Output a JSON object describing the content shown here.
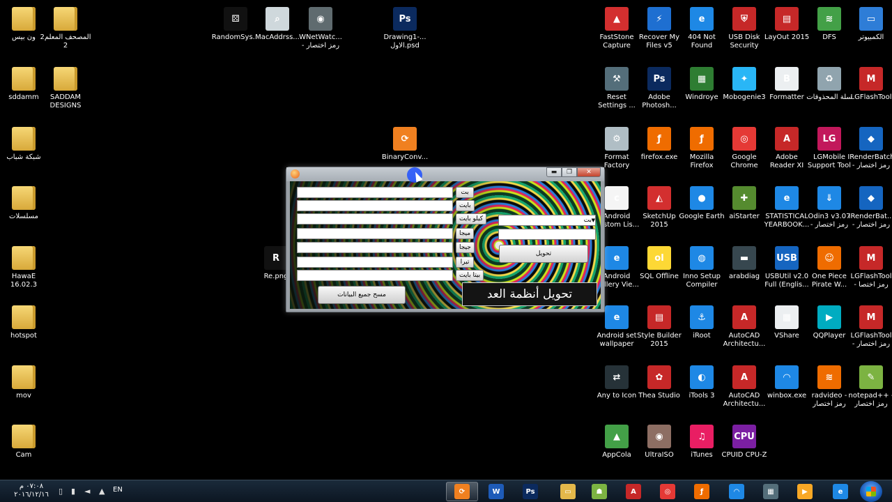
{
  "desktop": {
    "left_icons": [
      {
        "label": "ون بيس",
        "kind": "folder"
      },
      {
        "label": "المصحف المعلم2\n2",
        "kind": "folder"
      },
      {
        "label": "sddamm",
        "kind": "folder"
      },
      {
        "label": "SADDAM\nDESIGNS",
        "kind": "folder"
      },
      {
        "label": "شبكة شباب",
        "kind": "folder"
      },
      {
        "label": "مسلسلات",
        "kind": "folder"
      },
      {
        "label": "HawaE\n16.02.3",
        "kind": "folder"
      },
      {
        "label": "hotspot",
        "kind": "folder"
      },
      {
        "label": "mov",
        "kind": "folder"
      },
      {
        "label": "Cam",
        "kind": "folder"
      }
    ],
    "center_icons": [
      {
        "label": "RandomSys...",
        "glyph": "⚄",
        "color": "#111111"
      },
      {
        "label": "MacAddrss...",
        "glyph": "⌕",
        "color": "#cfd8dc"
      },
      {
        "label": "WNetWatc...\n- رمز اختصار",
        "glyph": "◉",
        "color": "#5f6b6f"
      },
      {
        "label": "Drawing1-...\nالاول.psd",
        "glyph": "Ps",
        "color": "#0b2a5e"
      },
      {
        "label": "BinaryConv...",
        "glyph": "⟳",
        "color": "#f08020"
      },
      {
        "label": "Re.png",
        "glyph": "R",
        "color": "#111111"
      }
    ],
    "right_icons": [
      {
        "label": "FastStone\nCapture",
        "glyph": "▲",
        "color": "#d32f2f"
      },
      {
        "label": "Recover My\nFiles v5",
        "glyph": "⚡",
        "color": "#1e6fd1"
      },
      {
        "label": "404 Not\nFound",
        "glyph": "e",
        "color": "#1e88e5"
      },
      {
        "label": "USB Disk\nSecurity",
        "glyph": "⛨",
        "color": "#c62828"
      },
      {
        "label": "LayOut 2015",
        "glyph": "▤",
        "color": "#c62828"
      },
      {
        "label": "DFS",
        "glyph": "≋",
        "color": "#43a047"
      },
      {
        "label": "الكمبيوتر",
        "glyph": "▭",
        "color": "#2e7dd7"
      },
      {
        "label": "Reset\nSettings ...",
        "glyph": "⚒",
        "color": "#546e7a"
      },
      {
        "label": "Adobe\nPhotosh...",
        "glyph": "Ps",
        "color": "#0b2a5e"
      },
      {
        "label": "Windroye",
        "glyph": "▦",
        "color": "#2e7d32"
      },
      {
        "label": "Mobogenie3",
        "glyph": "✦",
        "color": "#29b6f6"
      },
      {
        "label": "Formatter",
        "glyph": "B",
        "color": "#eceff1"
      },
      {
        "label": "سلة المحذوفات",
        "glyph": "♻",
        "color": "#90a4ae"
      },
      {
        "label": "LGFlashTool",
        "glyph": "M",
        "color": "#c62828"
      },
      {
        "label": "Format\nFactory",
        "glyph": "⚙",
        "color": "#b0bec5"
      },
      {
        "label": "firefox.exe",
        "glyph": "ƒ",
        "color": "#ef6c00"
      },
      {
        "label": "Mozilla\nFirefox",
        "glyph": "ƒ",
        "color": "#ef6c00"
      },
      {
        "label": "Google\nChrome",
        "glyph": "◎",
        "color": "#e53935"
      },
      {
        "label": "Adobe\nReader XI",
        "glyph": "A",
        "color": "#c62828"
      },
      {
        "label": "LGMobile\nSupport Tool",
        "glyph": "LG",
        "color": "#c2185b"
      },
      {
        "label": "IRenderBatch\n- رمز اختصار",
        "glyph": "◆",
        "color": "#1565c0"
      },
      {
        "label": "Android\nCustom Lis...",
        "glyph": "c",
        "color": "#f5f5f5"
      },
      {
        "label": "SketchUp\n2015",
        "glyph": "◭",
        "color": "#d32f2f"
      },
      {
        "label": "Google Earth",
        "glyph": "●",
        "color": "#1e88e5"
      },
      {
        "label": "aiStarter",
        "glyph": "✚",
        "color": "#558b2f"
      },
      {
        "label": "STATISTICAL\nYEARBOOK...",
        "glyph": "e",
        "color": "#1e88e5"
      },
      {
        "label": "Odin3 v3.07\n- رمز اختصار",
        "glyph": "⇓",
        "color": "#1e88e5"
      },
      {
        "label": "IRenderBat...\n- رمز اختصار",
        "glyph": "◆",
        "color": "#1565c0"
      },
      {
        "label": "Android\nGallery Vie...",
        "glyph": "e",
        "color": "#1e88e5"
      },
      {
        "label": "SQL Offline",
        "glyph": "ol",
        "color": "#fdd835"
      },
      {
        "label": "Inno Setup\nCompiler",
        "glyph": "◍",
        "color": "#1e88e5"
      },
      {
        "label": "arabdiag",
        "glyph": "▬",
        "color": "#37474f"
      },
      {
        "label": "USBUtil v2.0\nFull (Englis...",
        "glyph": "USB",
        "color": "#1565c0"
      },
      {
        "label": "One Piece\nPirate W...",
        "glyph": "☺",
        "color": "#ef6c00"
      },
      {
        "label": "LGFlashTool\n- رمز اختصا",
        "glyph": "M",
        "color": "#c62828"
      },
      {
        "label": "Android set\nwallpaper",
        "glyph": "e",
        "color": "#1e88e5"
      },
      {
        "label": "Style Builder\n2015",
        "glyph": "▤",
        "color": "#c62828"
      },
      {
        "label": "iRoot",
        "glyph": "⚓",
        "color": "#1e88e5"
      },
      {
        "label": "AutoCAD\nArchitectu...",
        "glyph": "A",
        "color": "#c62828"
      },
      {
        "label": "VShare",
        "glyph": "▦",
        "color": "#eceff1"
      },
      {
        "label": "QQPlayer",
        "glyph": "▶",
        "color": "#00acc1"
      },
      {
        "label": "LGFlashTool\n- رمز اختصار",
        "glyph": "M",
        "color": "#c62828"
      },
      {
        "label": "Any to Icon",
        "glyph": "⇄",
        "color": "#263238"
      },
      {
        "label": "Thea Studio",
        "glyph": "✿",
        "color": "#c62828"
      },
      {
        "label": "iTools 3",
        "glyph": "◐",
        "color": "#1e88e5"
      },
      {
        "label": "AutoCAD\nArchitectu...",
        "glyph": "A",
        "color": "#c62828"
      },
      {
        "label": "winbox.exe",
        "glyph": "◠",
        "color": "#1e88e5"
      },
      {
        "label": "radvideo -\nرمز اختصار",
        "glyph": "≋",
        "color": "#ef6c00"
      },
      {
        "label": "notepad++ -\nرمز اختصار",
        "glyph": "✎",
        "color": "#7cb342"
      },
      {
        "label": "AppCola",
        "glyph": "▲",
        "color": "#43a047"
      },
      {
        "label": "UltraISO",
        "glyph": "◉",
        "color": "#8d6e63"
      },
      {
        "label": "iTunes",
        "glyph": "♫",
        "color": "#e91e63"
      },
      {
        "label": "CPUID CPU-Z",
        "glyph": "CPU",
        "color": "#7b1fa2"
      }
    ]
  },
  "app": {
    "unit_buttons": [
      "بت",
      "بايت",
      "كيلو بايت",
      "ميجا",
      "جيجا",
      "تيرا",
      "بيتا بايت"
    ],
    "combo_selected": "بت",
    "convert_label": "تحويل",
    "clear_label": "مسح جميع البيانات",
    "banner": "تحويل أنظمة العد الحاسوبيه",
    "titlebar": {
      "min": "▬",
      "max": "❐",
      "close": "✕"
    }
  },
  "taskbar": {
    "clock_time": "٠٧:٠٨ م",
    "clock_date": "٢٠١٦/١٢/١٦",
    "lang": "EN",
    "items": [
      {
        "name": "binary-converter",
        "glyph": "⟳",
        "color": "#f08020",
        "active": true
      },
      {
        "name": "word",
        "glyph": "W",
        "color": "#1e5bb8",
        "active": false
      },
      {
        "name": "photoshop",
        "glyph": "Ps",
        "color": "#0b2a5e",
        "active": false
      },
      {
        "name": "explorer",
        "glyph": "▭",
        "color": "#e4b84a",
        "active": false
      },
      {
        "name": "android",
        "glyph": "☗",
        "color": "#7cb342",
        "active": false
      },
      {
        "name": "adobe-reader",
        "glyph": "A",
        "color": "#c62828",
        "active": false
      },
      {
        "name": "chrome",
        "glyph": "◎",
        "color": "#e53935",
        "active": false
      },
      {
        "name": "firefox",
        "glyph": "ƒ",
        "color": "#ef6c00",
        "active": false
      },
      {
        "name": "winbox",
        "glyph": "◠",
        "color": "#1e88e5",
        "active": false
      },
      {
        "name": "network-tool",
        "glyph": "▦",
        "color": "#546e7a",
        "active": false
      },
      {
        "name": "media-player",
        "glyph": "▶",
        "color": "#f9a825",
        "active": false
      },
      {
        "name": "internet-explorer",
        "glyph": "e",
        "color": "#1e88e5",
        "active": false
      }
    ]
  }
}
